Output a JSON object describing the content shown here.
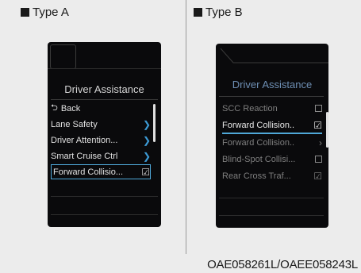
{
  "type_a": {
    "label": "Type A",
    "title": "Driver Assistance",
    "back": "Back",
    "items": [
      {
        "label": "Lane Safety",
        "icon": "chevron-right-icon"
      },
      {
        "label": "Driver Attention...",
        "icon": "chevron-right-icon"
      },
      {
        "label": "Smart Cruise Ctrl",
        "icon": "chevron-right-icon"
      },
      {
        "label": "Forward Collisio...",
        "icon": "checked-box-icon",
        "selected": true
      }
    ]
  },
  "type_b": {
    "label": "Type B",
    "title": "Driver Assistance",
    "items": [
      {
        "label": "SCC Reaction",
        "icon": "checkbox-icon"
      },
      {
        "label": "Forward Collision..",
        "icon": "checked-box-icon",
        "selected": true
      },
      {
        "label": "Forward Collision..",
        "icon": "chevron-right-icon"
      },
      {
        "label": "Blind-Spot Collisi...",
        "icon": "checkbox-icon"
      },
      {
        "label": "Rear Cross Traf...",
        "icon": "checked-box-icon"
      }
    ]
  },
  "image_code": "OAE058261L/OAEE058243L",
  "colors": {
    "accent": "#4fa8d8",
    "screen_bg": "#0a0a0c",
    "title_b": "#6e8fb4"
  }
}
